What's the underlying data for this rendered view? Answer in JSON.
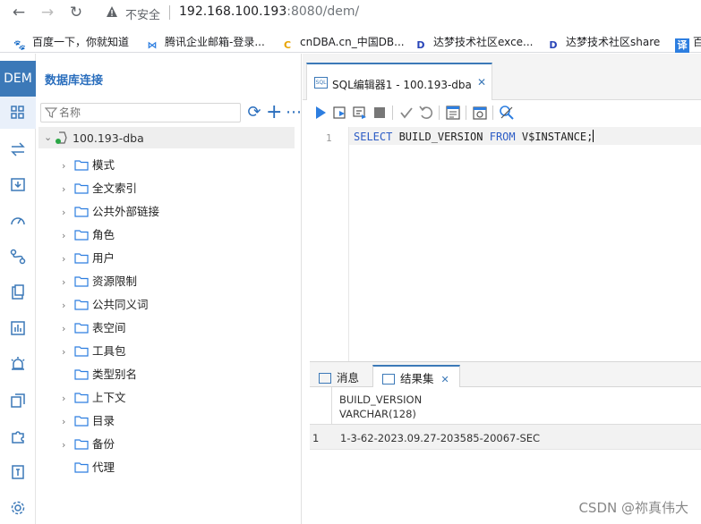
{
  "browser": {
    "insecure_label": "不安全",
    "url_host": "192.168.100.193",
    "url_rest": ":8080/dem/"
  },
  "bookmarks": [
    {
      "label": "百度一下，你就知道",
      "icon": "baidu-icon"
    },
    {
      "label": "腾讯企业邮箱-登录...",
      "icon": "tencent-mail-icon"
    },
    {
      "label": "cnDBA.cn_中国DB...",
      "icon": "cndba-icon"
    },
    {
      "label": "达梦技术社区exce...",
      "icon": "dameng-icon"
    },
    {
      "label": "达梦技术社区share",
      "icon": "dameng-icon"
    },
    {
      "label": "译",
      "icon": "translate-icon"
    },
    {
      "label": "百"
    }
  ],
  "app": {
    "logo": "DEM",
    "panel_title": "数据库连接",
    "filter_placeholder": "名称"
  },
  "tree": {
    "root": "100.193-dba",
    "items": [
      "模式",
      "全文索引",
      "公共外部链接",
      "角色",
      "用户",
      "资源限制",
      "公共同义词",
      "表空间",
      "工具包",
      "类型别名",
      "上下文",
      "目录",
      "备份",
      "代理"
    ]
  },
  "editor": {
    "tab_label": "SQL编辑器1 - 100.193-dba",
    "tab_icon_text": "SQL",
    "line_number": "1",
    "sql_kw1": "SELECT",
    "sql_mid": " BUILD_VERSION ",
    "sql_kw2": "FROM",
    "sql_end": " V$INSTANCE;"
  },
  "results": {
    "tab_messages": "消息",
    "tab_results": "结果集",
    "column_name": "BUILD_VERSION",
    "column_type": "VARCHAR(128)",
    "row_number": "1",
    "row_value": "1-3-62-2023.09.27-203585-20067-SEC"
  },
  "watermark": "CSDN @祢真伟大",
  "colors": {
    "accent": "#3c79b8",
    "link": "#2a6ebd"
  }
}
